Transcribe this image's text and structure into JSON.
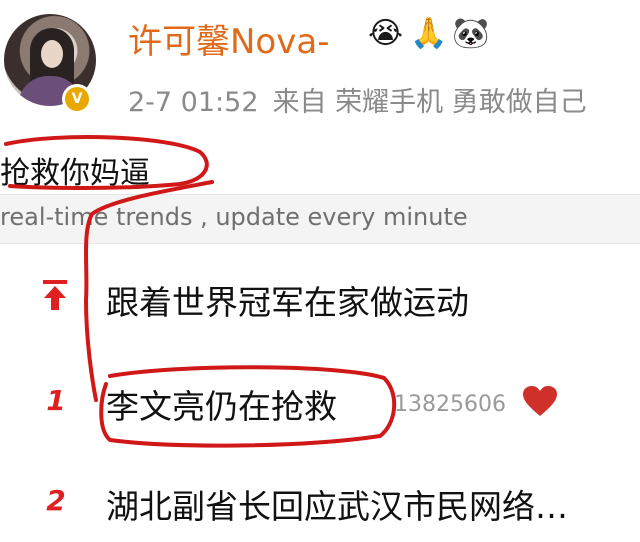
{
  "post": {
    "username": "许可馨Nova-",
    "emojis": [
      "😭",
      "🙏",
      "🐼"
    ],
    "time": "2-7 01:52",
    "source": "来自 荣耀手机 勇敢做自己",
    "text": "抢救你妈逼"
  },
  "trends": {
    "banner": "real-time trends , update every minute",
    "items": [
      {
        "rank": "↑",
        "title": "跟着世界冠军在家做运动",
        "count": ""
      },
      {
        "rank": "1",
        "title": "李文亮仍在抢救",
        "count": "13825606"
      },
      {
        "rank": "2",
        "title": "湖北副省长回应武汉市民网络…",
        "count": ""
      }
    ]
  },
  "colors": {
    "username": "#e06a1a",
    "rank": "#e02020",
    "annotation": "#d01818",
    "heart": "#d0302a"
  },
  "icons": {
    "verified": "verified-badge-icon",
    "pin": "pin-up-arrow-icon",
    "hot": "heart-icon"
  }
}
